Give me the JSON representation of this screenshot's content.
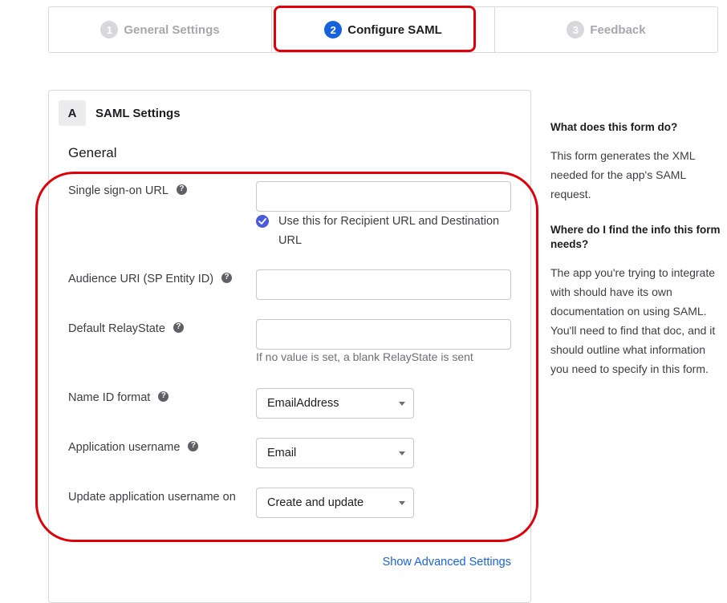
{
  "stepper": {
    "steps": [
      {
        "num": "1",
        "label": "General Settings"
      },
      {
        "num": "2",
        "label": "Configure SAML"
      },
      {
        "num": "3",
        "label": "Feedback"
      }
    ]
  },
  "section": {
    "letter": "A",
    "title": "SAML Settings",
    "group_heading": "General"
  },
  "form": {
    "sso_url": {
      "label": "Single sign-on URL",
      "value": ""
    },
    "recipient_checkbox": {
      "label": "Use this for Recipient URL and Destination URL",
      "checked": true
    },
    "audience_uri": {
      "label": "Audience URI (SP Entity ID)",
      "value": ""
    },
    "relay_state": {
      "label": "Default RelayState",
      "value": "",
      "hint": "If no value is set, a blank RelayState is sent"
    },
    "name_id_format": {
      "label": "Name ID format",
      "value": "EmailAddress"
    },
    "app_username": {
      "label": "Application username",
      "value": "Email"
    },
    "update_username_on": {
      "label": "Update application username on",
      "value": "Create and update"
    },
    "advanced_link": "Show Advanced Settings"
  },
  "aside": {
    "q1": "What does this form do?",
    "a1": "This form generates the XML needed for the app's SAML request.",
    "q2": "Where do I find the info this form needs?",
    "a2": "The app you're trying to integrate with should have its own documentation on using SAML. You'll need to find that doc, and it should outline what information you need to specify in this form."
  },
  "colors": {
    "accent": "#1662dd",
    "highlight": "#e0000a",
    "checkbox": "#4a5bdc"
  },
  "icons": {
    "help": "question-circle-icon",
    "check": "check-icon",
    "dropdown": "chevron-down-icon"
  }
}
